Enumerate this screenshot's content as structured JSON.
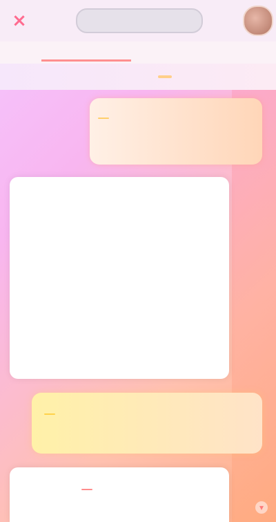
{
  "topbar": {
    "close_icon": "×",
    "title": "",
    "avatar_icon": "profile-avatar"
  },
  "tabs": [
    {
      "label": ""
    },
    {
      "label": ""
    }
  ],
  "notice": {
    "text": "",
    "highlight": ""
  },
  "tip_card": {
    "line1": "",
    "line2": "",
    "badge": ""
  },
  "main_card": {
    "para1": "",
    "para2": "",
    "tag": "",
    "para3": ""
  },
  "note_card": {
    "title": "",
    "body": "",
    "chip": ""
  },
  "bottom_card": {
    "line": "",
    "chip": ""
  },
  "colors": {
    "accent_red": "#ff6b8f",
    "accent_orange": "#ffcf8a",
    "card_bg": "#ffffff"
  }
}
